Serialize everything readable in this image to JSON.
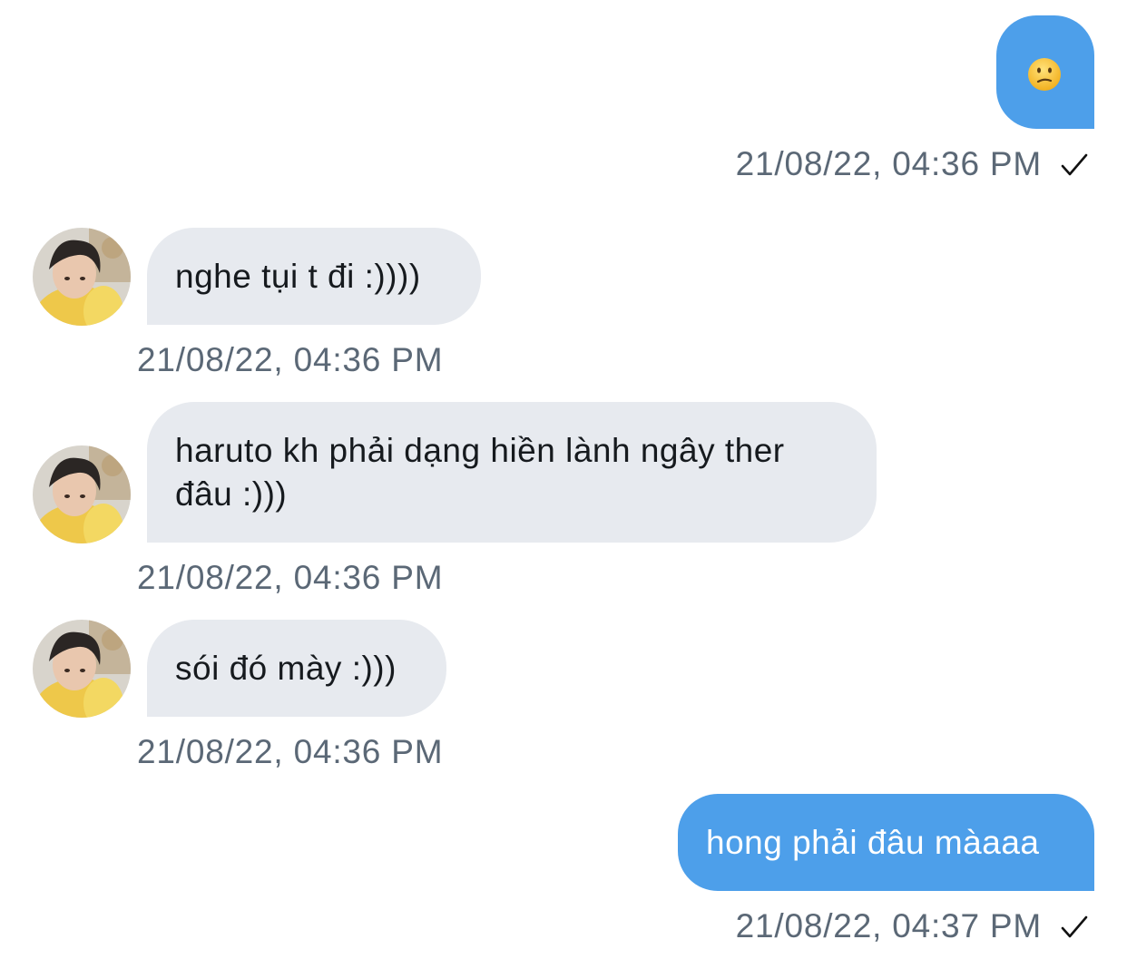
{
  "messages": [
    {
      "direction": "sent",
      "text": "😕",
      "emoji_name": "confused-face",
      "timestamp": "21/08/22, 04:36 PM",
      "status_icon": "checkmark-icon"
    },
    {
      "direction": "received",
      "text": "nghe tụi t đi :))))",
      "timestamp": "21/08/22, 04:36 PM",
      "avatar_icon": "contact-avatar"
    },
    {
      "direction": "received",
      "text": "haruto kh phải dạng hiền lành ngây ther đâu :)))",
      "timestamp": "21/08/22, 04:36 PM",
      "avatar_icon": "contact-avatar"
    },
    {
      "direction": "received",
      "text": "sói đó mày :)))",
      "timestamp": "21/08/22, 04:36 PM",
      "avatar_icon": "contact-avatar"
    },
    {
      "direction": "sent",
      "text": "hong phải đâu màaaa",
      "timestamp": "21/08/22, 04:37 PM",
      "status_icon": "checkmark-icon"
    }
  ],
  "colors": {
    "sent_bubble": "#4d9fea",
    "received_bubble": "#e7eaef",
    "received_text": "#161a1e",
    "timestamp": "#5b6876",
    "emoji_face": "#f7c531"
  }
}
